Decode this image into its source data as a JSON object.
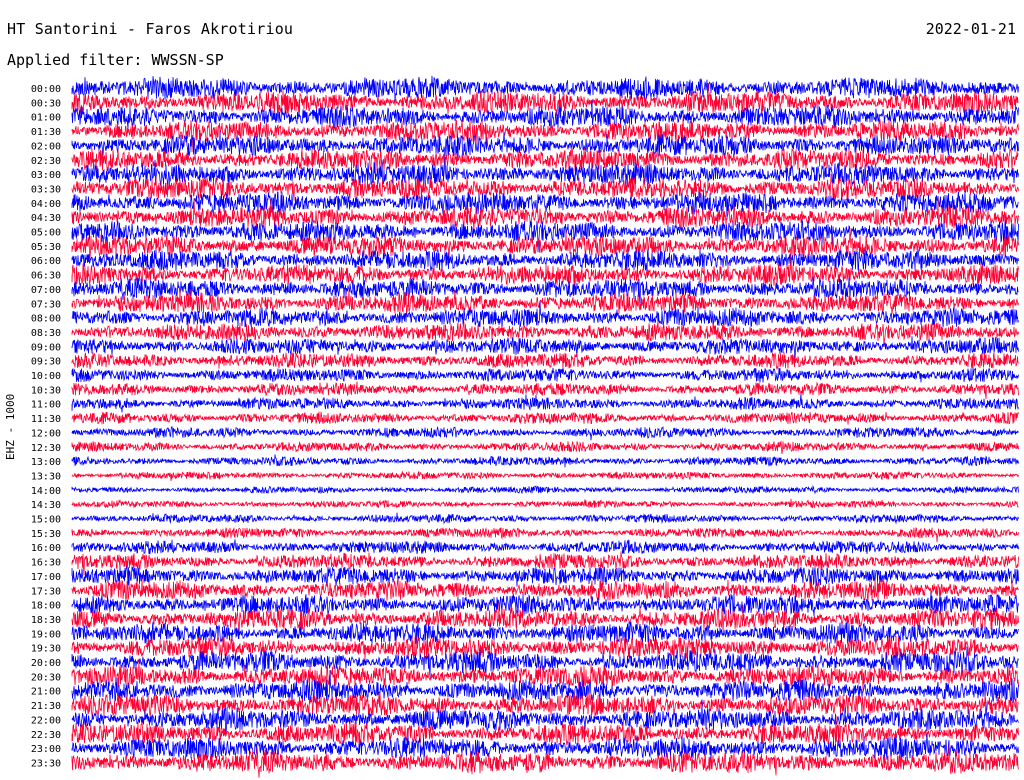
{
  "header": {
    "title": "HT Santorini - Faros Akrotiriou",
    "date": "2022-01-21",
    "filter": "Applied filter: WWSSN-SP"
  },
  "colors": {
    "trace_a": "#0000ff",
    "trace_b": "#ff0033",
    "background": "#ffffff",
    "text": "#000000"
  },
  "chart_data": {
    "type": "line",
    "title": "HT Santorini - Faros Akrotiriou",
    "ylabel": "EHZ - 1000",
    "xlabel": "",
    "grid": false,
    "legend": "none",
    "categories": [
      "00:00",
      "00:30",
      "01:00",
      "01:30",
      "02:00",
      "02:30",
      "03:00",
      "03:30",
      "04:00",
      "04:30",
      "05:00",
      "05:30",
      "06:00",
      "06:30",
      "07:00",
      "07:30",
      "08:00",
      "08:30",
      "09:00",
      "09:30",
      "10:00",
      "10:30",
      "11:00",
      "11:30",
      "12:00",
      "12:30",
      "13:00",
      "13:30",
      "14:00",
      "14:30",
      "15:00",
      "15:30",
      "16:00",
      "16:30",
      "17:00",
      "17:30",
      "18:00",
      "18:30",
      "19:00",
      "19:30",
      "20:00",
      "20:30",
      "21:00",
      "21:30",
      "22:00",
      "22:30",
      "23:00",
      "23:30"
    ],
    "trace_colors": [
      "#0000ff",
      "#ff0033"
    ],
    "relative_amplitude": [
      1.0,
      1.0,
      0.98,
      0.98,
      0.97,
      0.98,
      0.99,
      1.0,
      1.0,
      0.98,
      0.98,
      0.97,
      0.94,
      0.93,
      0.92,
      0.9,
      0.86,
      0.82,
      0.76,
      0.7,
      0.62,
      0.58,
      0.55,
      0.52,
      0.48,
      0.44,
      0.4,
      0.34,
      0.3,
      0.32,
      0.38,
      0.46,
      0.58,
      0.7,
      0.82,
      0.88,
      0.9,
      0.93,
      0.95,
      0.97,
      0.98,
      0.99,
      1.0,
      1.0,
      1.0,
      1.0,
      1.0,
      1.0
    ]
  }
}
